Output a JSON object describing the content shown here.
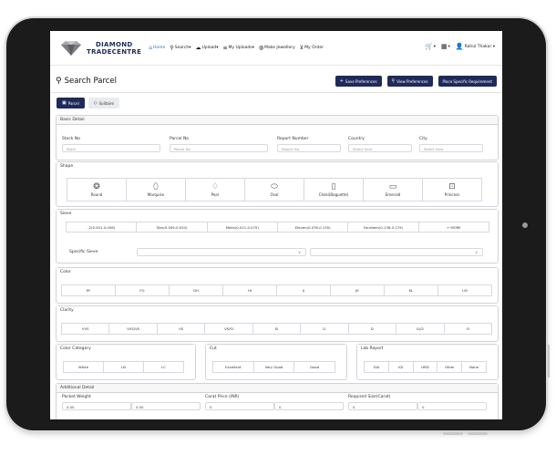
{
  "brand": {
    "line1": "DIAMOND",
    "line2": "TRADECENTRE"
  },
  "nav": {
    "home": "Home",
    "search": "Search",
    "upload": "Upload",
    "my_uploads": "My Uploads",
    "make_jewellery": "Make Jewellery",
    "my_order": "My Order",
    "user": "Rahul Thakar"
  },
  "page": {
    "title": "Search Parcel",
    "save_preferences": "Save Preferences",
    "view_preferences": "View Preferences",
    "place_requirement": "Place Specific Requirement"
  },
  "tabs": {
    "parcel": "Parcel",
    "solitaire": "Solitaire"
  },
  "basic": {
    "heading": "Basic Detail",
    "stock_label": "Stock No",
    "stock_ph": "Stock",
    "parcel_label": "Parcel No",
    "parcel_ph": "Parcel No",
    "report_label": "Report Number",
    "report_ph": "Report No",
    "country_label": "Country",
    "country_ph": "Select here",
    "city_label": "City",
    "city_ph": "Select here"
  },
  "shape": {
    "heading": "Shape",
    "items": [
      "Round",
      "Marquise",
      "Pear",
      "Oval",
      "Choki(Baguette)",
      "Emerald",
      "Princess"
    ]
  },
  "sieve": {
    "heading": "Sieve",
    "items": [
      "-2(0.001-0.006)",
      "Star(0.009-0.020)",
      "Melle(0.021-0.075)",
      "Eleven(0.076-0.135)",
      "Fourteen(0.136-0.179)",
      "+ MORE"
    ],
    "specific_label": "Specific Sieve"
  },
  "color": {
    "heading": "Color",
    "items": [
      "EF",
      "FG",
      "GH",
      "HI",
      "IJ",
      "JK",
      "KL",
      "LM"
    ]
  },
  "clarity": {
    "heading": "Clarity",
    "items": [
      "VVS",
      "VVS/VS",
      "VS",
      "VS/SI",
      "SI",
      "I1",
      "I2",
      "I1/I2",
      "I3"
    ]
  },
  "color_category": {
    "heading": "Color Category",
    "items": [
      "White",
      "LB",
      "LC"
    ]
  },
  "cut": {
    "heading": "Cut",
    "items": [
      "Excellent",
      "Very Good",
      "Good"
    ]
  },
  "lab": {
    "heading": "Lab Report",
    "items": [
      "GIA",
      "IGI",
      "HRD",
      "Other",
      "None"
    ]
  },
  "additional": {
    "heading": "Additional Detail",
    "packet_weight": "Packet Weight",
    "carat_price": "Carat Price (INR)",
    "required_size": "Required Size(Carat)",
    "pw_from": "0.00",
    "pw_to": "0.00",
    "cp_from": "0",
    "cp_to": "0",
    "rs_from": "0",
    "rs_to": "0"
  }
}
